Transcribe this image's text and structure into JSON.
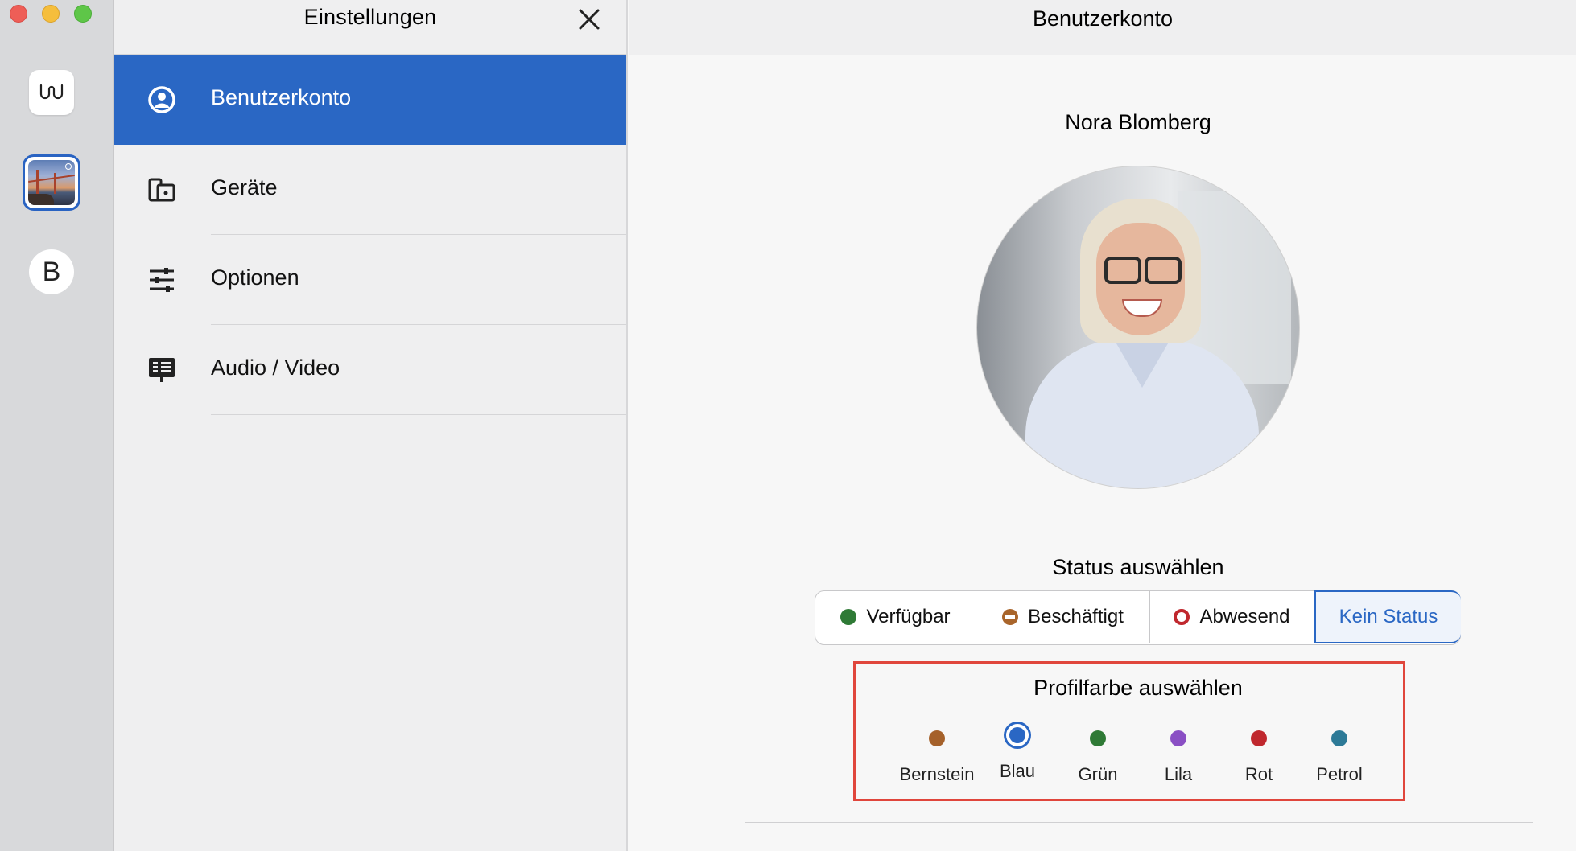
{
  "window": {
    "controls": [
      "close",
      "minimize",
      "zoom"
    ]
  },
  "app_bar": {
    "accounts": [
      {
        "name": "w-account",
        "icon": "wire-logo-icon"
      },
      {
        "name": "photo-account",
        "icon": "bridge-photo-avatar"
      },
      {
        "name": "b-account",
        "initial": "B"
      }
    ]
  },
  "sidebar": {
    "title": "Einstellungen",
    "close_icon": "close-icon",
    "items": [
      {
        "label": "Benutzerkonto",
        "icon": "user-circle-icon",
        "active": true
      },
      {
        "label": "Geräte",
        "icon": "devices-icon",
        "active": false
      },
      {
        "label": "Optionen",
        "icon": "sliders-icon",
        "active": false
      },
      {
        "label": "Audio / Video",
        "icon": "monitor-icon",
        "active": false
      }
    ]
  },
  "main": {
    "title": "Benutzerkonto",
    "user_name": "Nora Blomberg",
    "status": {
      "title": "Status auswählen",
      "options": [
        {
          "label": "Verfügbar",
          "color": "#2f7a36"
        },
        {
          "label": "Beschäftigt",
          "color": "#a9652b"
        },
        {
          "label": "Abwesend",
          "color": "#c0282e"
        },
        {
          "label": "Kein Status",
          "selected": true
        }
      ]
    },
    "profile_color": {
      "title": "Profilfarbe auswählen",
      "selected": "Blau",
      "options": [
        {
          "label": "Bernstein",
          "color": "#a5612a"
        },
        {
          "label": "Blau",
          "color": "#2a67c4"
        },
        {
          "label": "Grün",
          "color": "#2f7a36"
        },
        {
          "label": "Lila",
          "color": "#8a4fc4"
        },
        {
          "label": "Rot",
          "color": "#c0282e"
        },
        {
          "label": "Petrol",
          "color": "#2d7a97"
        }
      ]
    }
  },
  "colors": {
    "accent": "#2a67c4",
    "highlight_box": "#e0463c"
  }
}
